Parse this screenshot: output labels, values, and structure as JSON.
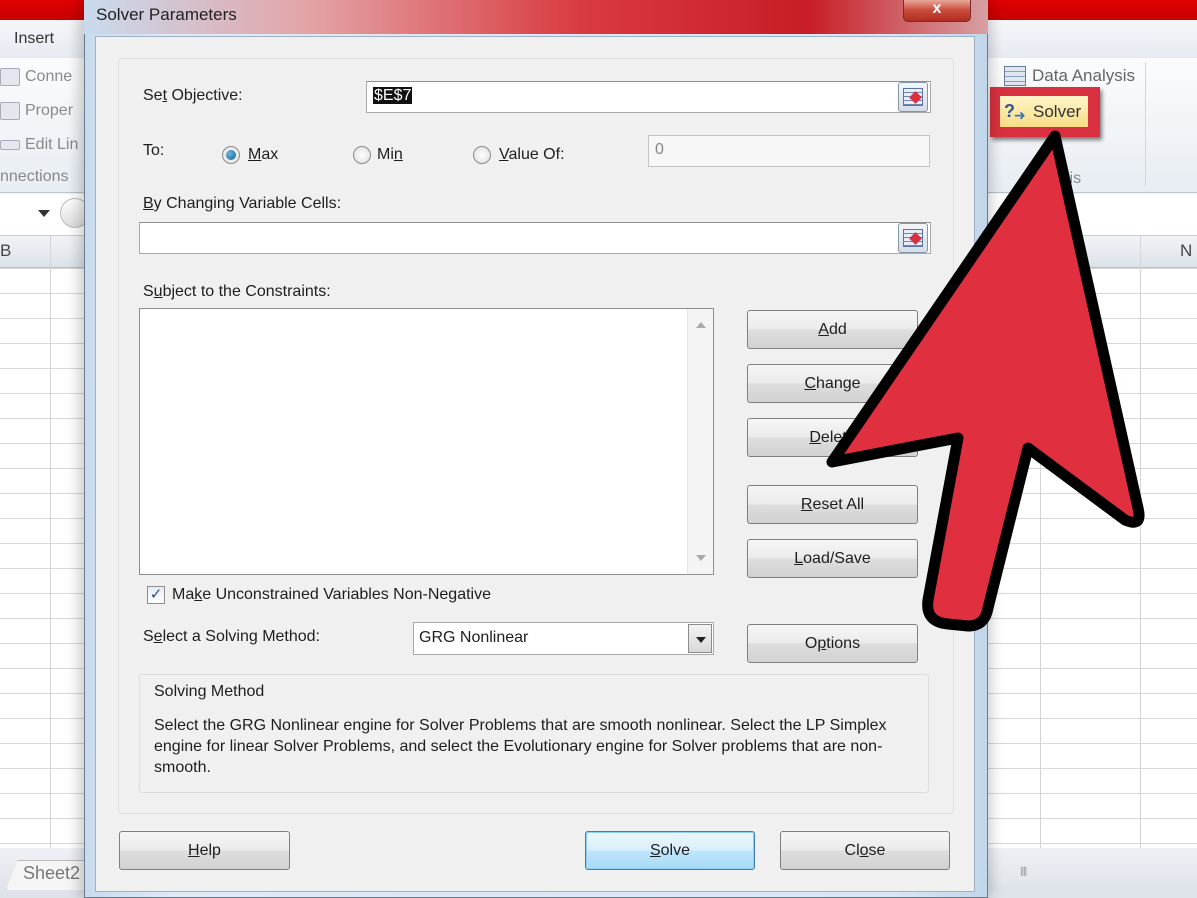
{
  "excel": {
    "ribbon_tab": "Insert",
    "ribbon_items": [
      "Conne",
      "Proper",
      "Edit Lin"
    ],
    "group_label_left": "nnections",
    "data_analysis_label": "Data Analysis",
    "solver_label": "Solver",
    "group_label_right": "lysis",
    "col_label_left": "B",
    "col_label_right": "N",
    "sheet_tab": "Sheet2"
  },
  "dialog": {
    "title": "Solver Parameters",
    "close_glyph": "x",
    "set_objective": {
      "label_pre": "Se",
      "label_ul": "t",
      "label_post": " Objective:",
      "value": "$E$7"
    },
    "to": {
      "label": "To:",
      "options": [
        {
          "pre": "",
          "ul": "M",
          "post": "ax",
          "checked": true
        },
        {
          "pre": "Mi",
          "ul": "n",
          "post": "",
          "checked": false
        },
        {
          "pre": "",
          "ul": "V",
          "post": "alue Of:",
          "checked": false
        }
      ],
      "value_of": "0"
    },
    "changing_cells": {
      "label_pre": "",
      "label_ul": "B",
      "label_post": "y Changing Variable Cells:",
      "value": ""
    },
    "constraints": {
      "label_pre": "S",
      "label_ul": "u",
      "label_post": "bject to the Constraints:",
      "items": []
    },
    "side_buttons": {
      "add": {
        "pre": "",
        "ul": "A",
        "post": "dd"
      },
      "change": {
        "pre": "",
        "ul": "C",
        "post": "hange"
      },
      "delete": {
        "pre": "",
        "ul": "D",
        "post": "elete"
      },
      "reset": {
        "pre": "",
        "ul": "R",
        "post": "eset All"
      },
      "loadsave": {
        "pre": "",
        "ul": "L",
        "post": "oad/Save"
      },
      "options": {
        "pre": "O",
        "ul": "p",
        "post": "tions"
      }
    },
    "nonneg": {
      "checked": true,
      "check_glyph": "✓",
      "label_pre": "Ma",
      "label_ul": "k",
      "label_post": "e Unconstrained Variables Non-Negative"
    },
    "method": {
      "label_pre": "S",
      "label_ul": "e",
      "label_post": "lect a Solving Method:",
      "selected": "GRG Nonlinear"
    },
    "method_group": {
      "title": "Solving Method",
      "description": "Select the GRG Nonlinear engine for Solver Problems that are smooth nonlinear. Select the LP Simplex engine for linear Solver Problems, and select the Evolutionary engine for Solver problems that are non-smooth."
    },
    "bottom_buttons": {
      "help": {
        "pre": "",
        "ul": "H",
        "post": "elp"
      },
      "solve": {
        "pre": "",
        "ul": "S",
        "post": "olve"
      },
      "close": {
        "pre": "Cl",
        "ul": "o",
        "post": "se"
      }
    }
  },
  "annotation": {
    "arrow_color": "#e03040",
    "highlight_color": "#d8303e",
    "points_to": "Solver"
  }
}
